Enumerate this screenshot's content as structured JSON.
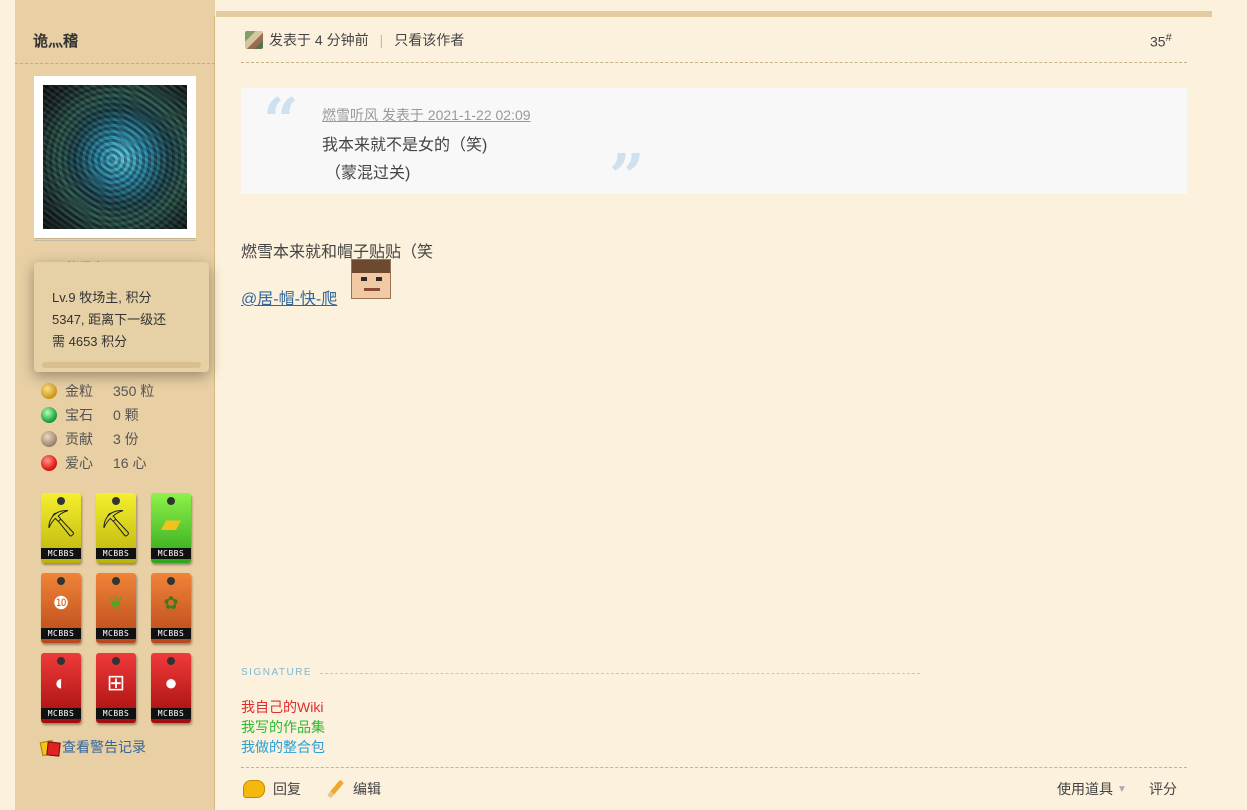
{
  "user": {
    "username": "诡灬稽",
    "level_peek": "Lv.9 牧场主",
    "tooltip": [
      "Lv.9 牧场主, 积分",
      "5347, 距离下一级还",
      "需 4653 积分"
    ],
    "stats": [
      {
        "label": "金粒",
        "value": "350 粒",
        "icon": "gold-nugget-icon"
      },
      {
        "label": "宝石",
        "value": "0 颗",
        "icon": "emerald-icon"
      },
      {
        "label": "贡献",
        "value": "3 份",
        "icon": "contribution-icon"
      },
      {
        "label": "爱心",
        "value": "16 心",
        "icon": "apple-heart-icon"
      }
    ],
    "medal_tag": "MCBBS",
    "warn_link": "查看警告记录"
  },
  "post": {
    "posted": "发表于 4 分钟前",
    "only_author": "只看该作者",
    "floor": "35",
    "floor_sup": "#",
    "quote": {
      "author_line": "燃雪听风 发表于 2021-1-22 02:09",
      "lines": [
        "我本来就不是女的（笑)",
        "（蒙混过关)"
      ]
    },
    "body_line": "燃雪本来就和帽子贴贴（笑",
    "mention": "@居-帽-快-爬"
  },
  "signature": {
    "label": "SIGNATURE",
    "links": [
      {
        "text": "我自己的Wiki",
        "color": "#e02c2c"
      },
      {
        "text": "我写的作品集",
        "color": "#2fb82f"
      },
      {
        "text": "我做的整合包",
        "color": "#2a9fd6"
      }
    ]
  },
  "footer": {
    "reply": "回复",
    "edit": "编辑",
    "tools": "使用道具",
    "rate": "评分"
  },
  "colors": {
    "page_bg": "#fbf1dc",
    "sidebar_bg": "#e8cfa4",
    "link": "#336699"
  }
}
